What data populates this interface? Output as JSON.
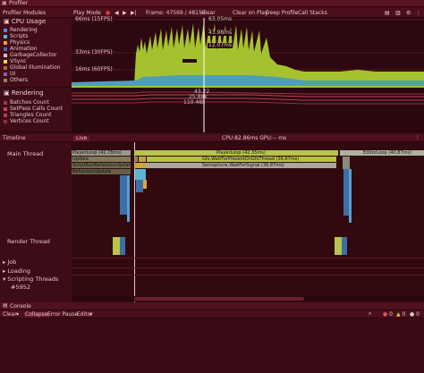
{
  "window": {
    "title": "Profiler"
  },
  "toolbar": {
    "modules_label": "Profiler Modules",
    "play_mode": "Play Mode",
    "frame_label": "Frame: 47569 / 48154",
    "clear": "Clear",
    "clear_on_play": "Clear on Play",
    "deep_profile": "Deep Profile",
    "call_stacks": "Call Stacks"
  },
  "cpu_module": {
    "title": "CPU Usage",
    "items": [
      {
        "label": "Rendering",
        "color": "#4f8fce"
      },
      {
        "label": "Scripts",
        "color": "#5cb3d3"
      },
      {
        "label": "Physics",
        "color": "#e0a43a"
      },
      {
        "label": "Animation",
        "color": "#3d6fa6"
      },
      {
        "label": "GarbageCollector",
        "color": "#c6c6c6"
      },
      {
        "label": "VSync",
        "color": "#e6d84c"
      },
      {
        "label": "Global Illumination",
        "color": "#b16b2c"
      },
      {
        "label": "UI",
        "color": "#8a5fae"
      },
      {
        "label": "Others",
        "color": "#9d7d56"
      }
    ],
    "marker_66": "66ms (15FPS)",
    "marker_33": "33ms (30FPS)",
    "marker_16": "16ms (60FPS)",
    "sel_top": "63.05ms",
    "sel_mid": "43.98ms",
    "sel_low": "12.07ms"
  },
  "rendering_module": {
    "title": "Rendering",
    "items": [
      {
        "label": "Batches Count",
        "color": "#9d3640"
      },
      {
        "label": "SetPass Calls Count",
        "color": "#c04856"
      },
      {
        "label": "Triangles Count",
        "color": "#b1444f"
      },
      {
        "label": "Vertices Count",
        "color": "#8e3039"
      }
    ],
    "val1": "43.22",
    "val2": "25.88k",
    "val3": "110.48k"
  },
  "timeline": {
    "view_label": "Timeline",
    "mode": "Live",
    "cpu_gpu": "CPU:82.86ms   GPU:-- ms",
    "threads": {
      "main": "Main Thread",
      "render": "Render Thread",
      "job": "Job",
      "loading": "Loading",
      "scripting": "Scripting Threads",
      "scripting_id": "#5952"
    },
    "blocks": {
      "player_loop_left": "PlayerLoop (42.78ms)",
      "update_left": "Update",
      "script_run": "ScriptRunBehaviourUpdate",
      "behaviour_update": "BehaviourUpdate",
      "player_loop": "PlayerLoop (42.35ms)",
      "editor_loop": "EditorLoop (40.87ms)",
      "gfx_wait": "Gfx.WaitForPresentOnGfxThread (36.87ms)",
      "semaphore": "Semaphore.WaitForSignal (36.87ms)"
    }
  },
  "console": {
    "title": "Console",
    "clear": "Clear",
    "collapse": "Collapse",
    "error_pause": "Error Pause",
    "editor": "Editor",
    "count_errors": "0",
    "count_warnings": "0",
    "count_logs": "0"
  }
}
